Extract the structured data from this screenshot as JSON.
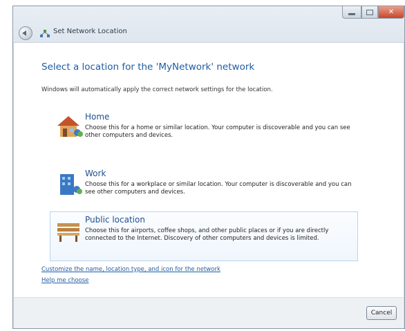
{
  "window": {
    "title": "Set Network Location"
  },
  "content": {
    "heading": "Select a location for the 'MyNetwork' network",
    "intro": "Windows will automatically apply the correct network settings for the location."
  },
  "options": [
    {
      "title": "Home",
      "description": "Choose this for a home or similar location. Your computer is discoverable and you can see other computers and devices."
    },
    {
      "title": "Work",
      "description": "Choose this for a workplace or similar location. Your computer is discoverable and you can see other computers and devices."
    },
    {
      "title": "Public location",
      "description": "Choose this for airports, coffee shops, and other public places or if you are directly connected to the Internet. Discovery of other computers and devices is limited."
    }
  ],
  "links": {
    "customize": "Customize the name, location type, and icon for the network",
    "help": "Help me choose"
  },
  "footer": {
    "cancel_label": "Cancel"
  }
}
